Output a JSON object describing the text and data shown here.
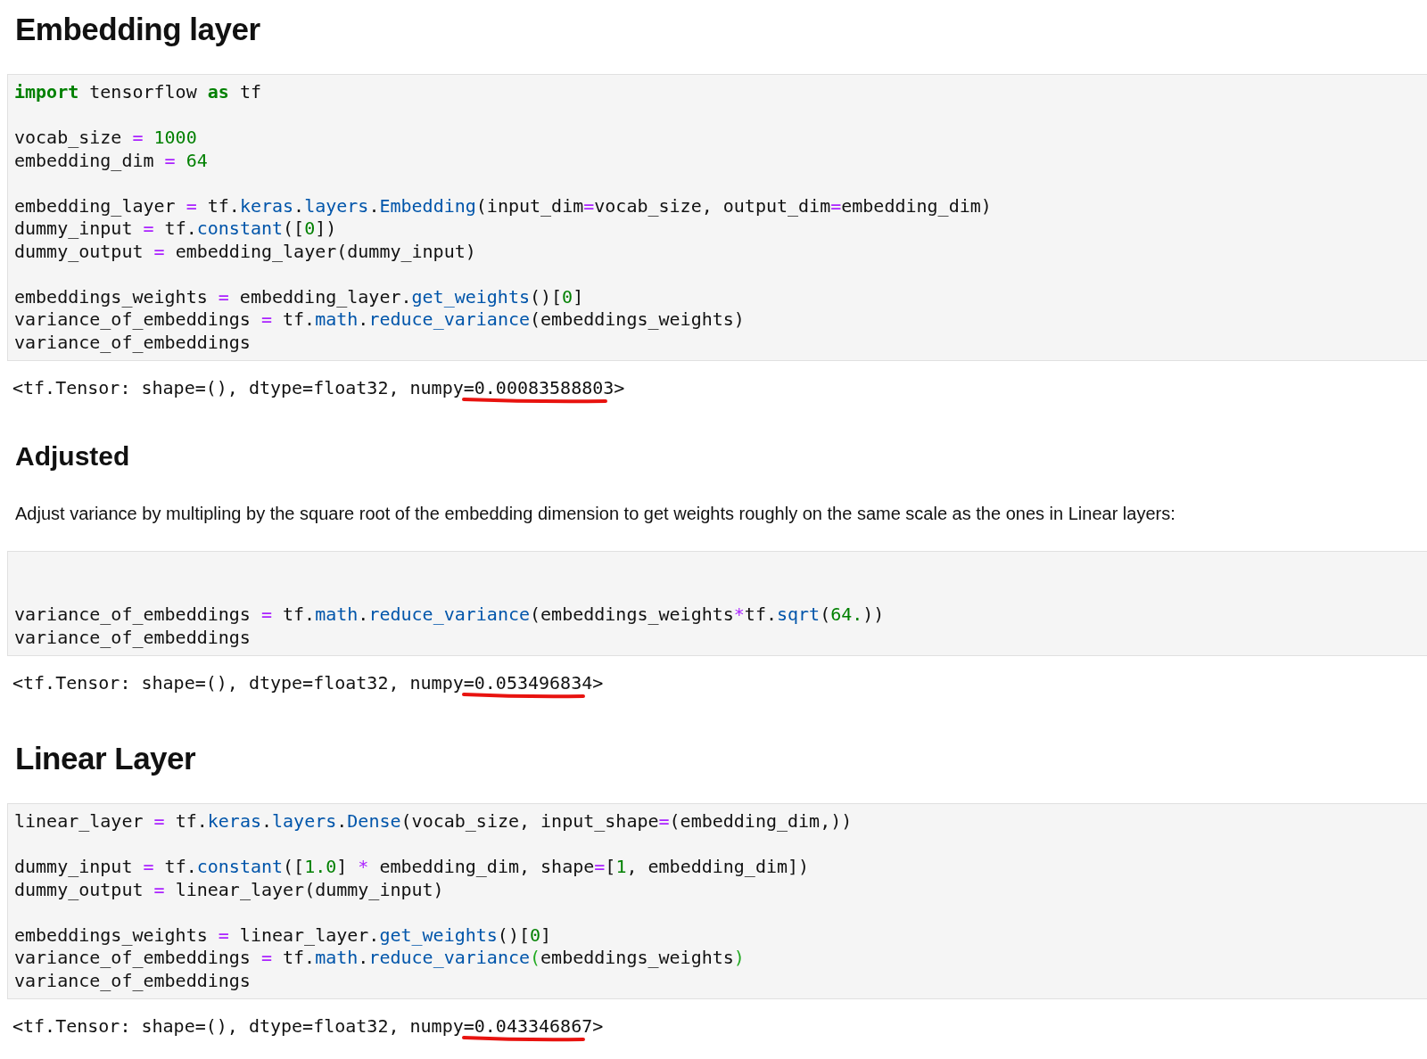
{
  "cells": [
    {
      "kind": "heading1",
      "text": "Embedding layer"
    },
    {
      "kind": "code",
      "padded_top": false,
      "lines": [
        {
          "gap_before": false,
          "tokens": [
            {
              "text": "import",
              "kind": "kw"
            },
            {
              "text": " tensorflow ",
              "kind": "plain"
            },
            {
              "text": "as",
              "kind": "kw"
            },
            {
              "text": " tf",
              "kind": "plain"
            }
          ]
        },
        {
          "gap_before": true,
          "tokens": [
            {
              "text": "vocab_size ",
              "kind": "plain"
            },
            {
              "text": "=",
              "kind": "op"
            },
            {
              "text": " 1000",
              "kind": "num"
            }
          ]
        },
        {
          "gap_before": false,
          "tokens": [
            {
              "text": "embedding_dim ",
              "kind": "plain"
            },
            {
              "text": "=",
              "kind": "op"
            },
            {
              "text": " 64",
              "kind": "num"
            }
          ]
        },
        {
          "gap_before": true,
          "tokens": [
            {
              "text": "embedding_layer ",
              "kind": "plain"
            },
            {
              "text": "=",
              "kind": "op"
            },
            {
              "text": " tf.",
              "kind": "plain"
            },
            {
              "text": "keras",
              "kind": "prop"
            },
            {
              "text": ".",
              "kind": "plain"
            },
            {
              "text": "layers",
              "kind": "prop"
            },
            {
              "text": ".",
              "kind": "plain"
            },
            {
              "text": "Embedding",
              "kind": "prop"
            },
            {
              "text": "(input_dim",
              "kind": "plain"
            },
            {
              "text": "=",
              "kind": "op"
            },
            {
              "text": "vocab_size, output_dim",
              "kind": "plain"
            },
            {
              "text": "=",
              "kind": "op"
            },
            {
              "text": "embedding_dim)",
              "kind": "plain"
            }
          ]
        },
        {
          "gap_before": false,
          "tokens": [
            {
              "text": "dummy_input ",
              "kind": "plain"
            },
            {
              "text": "=",
              "kind": "op"
            },
            {
              "text": " tf.",
              "kind": "plain"
            },
            {
              "text": "constant",
              "kind": "prop"
            },
            {
              "text": "([",
              "kind": "plain"
            },
            {
              "text": "0",
              "kind": "num"
            },
            {
              "text": "])",
              "kind": "plain"
            }
          ]
        },
        {
          "gap_before": false,
          "tokens": [
            {
              "text": "dummy_output ",
              "kind": "plain"
            },
            {
              "text": "=",
              "kind": "op"
            },
            {
              "text": " embedding_layer(dummy_input)",
              "kind": "plain"
            }
          ]
        },
        {
          "gap_before": true,
          "tokens": [
            {
              "text": "embeddings_weights ",
              "kind": "plain"
            },
            {
              "text": "=",
              "kind": "op"
            },
            {
              "text": " embedding_layer.",
              "kind": "plain"
            },
            {
              "text": "get_weights",
              "kind": "prop"
            },
            {
              "text": "()[",
              "kind": "plain"
            },
            {
              "text": "0",
              "kind": "num"
            },
            {
              "text": "]",
              "kind": "plain"
            }
          ]
        },
        {
          "gap_before": false,
          "tokens": [
            {
              "text": "variance_of_embeddings ",
              "kind": "plain"
            },
            {
              "text": "=",
              "kind": "op"
            },
            {
              "text": " tf.",
              "kind": "plain"
            },
            {
              "text": "math",
              "kind": "prop"
            },
            {
              "text": ".",
              "kind": "plain"
            },
            {
              "text": "reduce_variance",
              "kind": "prop"
            },
            {
              "text": "(embeddings_weights)",
              "kind": "plain"
            }
          ]
        },
        {
          "gap_before": false,
          "tokens": [
            {
              "text": "variance_of_embeddings",
              "kind": "plain"
            }
          ]
        }
      ]
    },
    {
      "kind": "output",
      "prefix": "<tf.Tensor: shape=(), dtype=float32, numpy=",
      "marked": "0.00083588803",
      "suffix": ">",
      "underlined": true
    },
    {
      "kind": "heading2",
      "text": "Adjusted"
    },
    {
      "kind": "paragraph",
      "text": "Adjust variance by multipling by the square root of the embedding dimension to get weights roughly on the same scale as the ones in Linear layers:"
    },
    {
      "kind": "code",
      "padded_top": true,
      "lines": [
        {
          "gap_before": false,
          "tokens": [
            {
              "text": "variance_of_embeddings ",
              "kind": "plain"
            },
            {
              "text": "=",
              "kind": "op"
            },
            {
              "text": " tf.",
              "kind": "plain"
            },
            {
              "text": "math",
              "kind": "prop"
            },
            {
              "text": ".",
              "kind": "plain"
            },
            {
              "text": "reduce_variance",
              "kind": "prop"
            },
            {
              "text": "(embeddings_weights",
              "kind": "plain"
            },
            {
              "text": "*",
              "kind": "op"
            },
            {
              "text": "tf.",
              "kind": "plain"
            },
            {
              "text": "sqrt",
              "kind": "prop"
            },
            {
              "text": "(",
              "kind": "plain"
            },
            {
              "text": "64.",
              "kind": "num"
            },
            {
              "text": "))",
              "kind": "plain"
            }
          ]
        },
        {
          "gap_before": false,
          "tokens": [
            {
              "text": "variance_of_embeddings",
              "kind": "plain"
            }
          ]
        }
      ]
    },
    {
      "kind": "output",
      "prefix": "<tf.Tensor: shape=(), dtype=float32, numpy=",
      "marked": "0.053496834",
      "suffix": ">",
      "underlined": true
    },
    {
      "kind": "heading1",
      "text": "Linear Layer"
    },
    {
      "kind": "code",
      "padded_top": false,
      "lines": [
        {
          "gap_before": false,
          "tokens": [
            {
              "text": "linear_layer ",
              "kind": "plain"
            },
            {
              "text": "=",
              "kind": "op"
            },
            {
              "text": " tf.",
              "kind": "plain"
            },
            {
              "text": "keras",
              "kind": "prop"
            },
            {
              "text": ".",
              "kind": "plain"
            },
            {
              "text": "layers",
              "kind": "prop"
            },
            {
              "text": ".",
              "kind": "plain"
            },
            {
              "text": "Dense",
              "kind": "prop"
            },
            {
              "text": "(vocab_size, input_shape",
              "kind": "plain"
            },
            {
              "text": "=",
              "kind": "op"
            },
            {
              "text": "(embedding_dim,))",
              "kind": "plain"
            }
          ]
        },
        {
          "gap_before": true,
          "tokens": [
            {
              "text": "dummy_input ",
              "kind": "plain"
            },
            {
              "text": "=",
              "kind": "op"
            },
            {
              "text": " tf.",
              "kind": "plain"
            },
            {
              "text": "constant",
              "kind": "prop"
            },
            {
              "text": "([",
              "kind": "plain"
            },
            {
              "text": "1.0",
              "kind": "num"
            },
            {
              "text": "] ",
              "kind": "plain"
            },
            {
              "text": "*",
              "kind": "op"
            },
            {
              "text": " embedding_dim, shape",
              "kind": "plain"
            },
            {
              "text": "=",
              "kind": "op"
            },
            {
              "text": "[",
              "kind": "plain"
            },
            {
              "text": "1",
              "kind": "num"
            },
            {
              "text": ", embedding_dim])",
              "kind": "plain"
            }
          ]
        },
        {
          "gap_before": false,
          "tokens": [
            {
              "text": "dummy_output ",
              "kind": "plain"
            },
            {
              "text": "=",
              "kind": "op"
            },
            {
              "text": " linear_layer(dummy_input)",
              "kind": "plain"
            }
          ]
        },
        {
          "gap_before": true,
          "tokens": [
            {
              "text": "embeddings_weights ",
              "kind": "plain"
            },
            {
              "text": "=",
              "kind": "op"
            },
            {
              "text": " linear_layer.",
              "kind": "plain"
            },
            {
              "text": "get_weights",
              "kind": "prop"
            },
            {
              "text": "()[",
              "kind": "plain"
            },
            {
              "text": "0",
              "kind": "num"
            },
            {
              "text": "]",
              "kind": "plain"
            }
          ]
        },
        {
          "gap_before": false,
          "tokens": [
            {
              "text": "variance_of_embeddings ",
              "kind": "plain"
            },
            {
              "text": "=",
              "kind": "op"
            },
            {
              "text": " tf.",
              "kind": "plain"
            },
            {
              "text": "math",
              "kind": "prop"
            },
            {
              "text": ".",
              "kind": "plain"
            },
            {
              "text": "reduce_variance",
              "kind": "prop"
            },
            {
              "text": "(",
              "kind": "match"
            },
            {
              "text": "embeddings_weights",
              "kind": "plain"
            },
            {
              "text": ")",
              "kind": "match"
            }
          ]
        },
        {
          "gap_before": false,
          "tokens": [
            {
              "text": "variance_of_embeddings",
              "kind": "plain"
            }
          ]
        }
      ]
    },
    {
      "kind": "output",
      "prefix": "<tf.Tensor: shape=(), dtype=float32, numpy=",
      "marked": "0.043346867",
      "suffix": ">",
      "underlined": true
    }
  ]
}
